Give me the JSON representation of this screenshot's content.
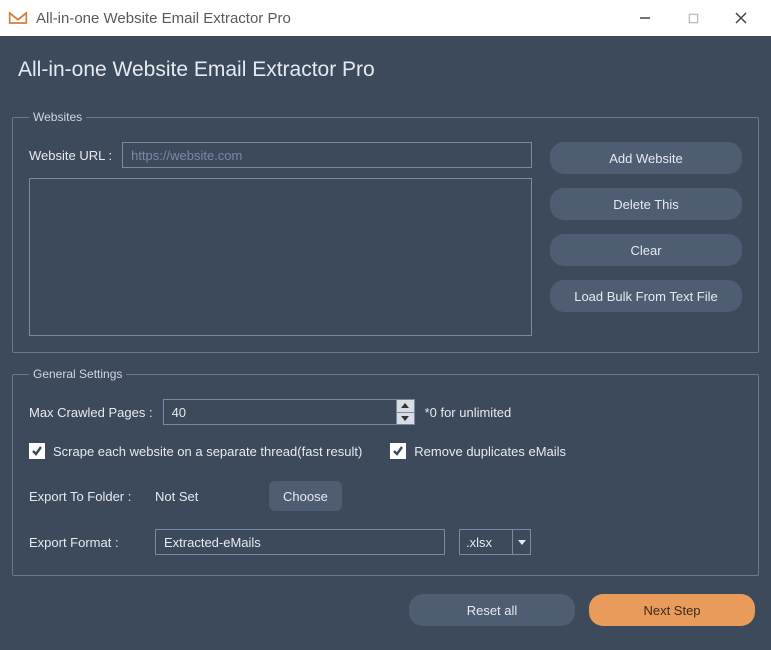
{
  "window": {
    "title": "All-in-one Website Email Extractor Pro"
  },
  "header": {
    "title": "All-in-one Website Email Extractor Pro"
  },
  "websites": {
    "legend": "Websites",
    "url_label": "Website URL :",
    "url_placeholder": "https://website.com",
    "url_value": "",
    "buttons": {
      "add": "Add Website",
      "delete": "Delete This",
      "clear": "Clear",
      "load_bulk": "Load Bulk From Text File"
    }
  },
  "settings": {
    "legend": "General Settings",
    "max_crawled_label": "Max Crawled Pages :",
    "max_crawled_value": "40",
    "max_crawled_hint": "*0 for unlimited",
    "scrape_thread_label": "Scrape each website on a separate thread(fast result)",
    "remove_dup_label": "Remove duplicates eMails",
    "export_folder_label": "Export To Folder :",
    "export_folder_value": "Not Set",
    "choose_label": "Choose",
    "export_format_label": "Export Format :",
    "export_format_value": "Extracted-eMails",
    "export_ext": ".xlsx"
  },
  "footer": {
    "reset": "Reset all",
    "next": "Next Step"
  }
}
